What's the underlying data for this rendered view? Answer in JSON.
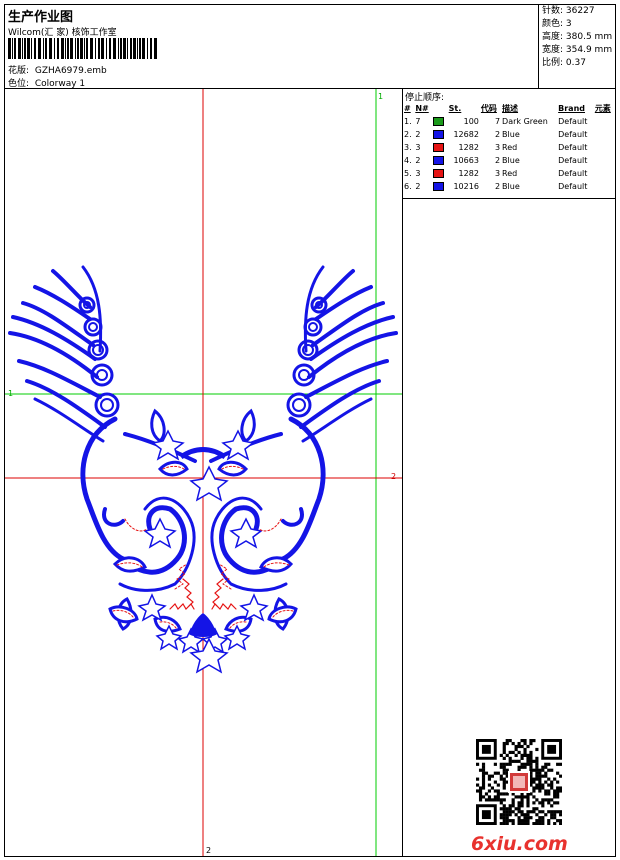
{
  "header": {
    "title": "生产作业图",
    "company": "Wilcom(汇 家) 核饰工作室",
    "meta": [
      {
        "label": "花版:",
        "value": "GZHA6979.emb"
      },
      {
        "label": "色位:",
        "value": "Colorway 1"
      }
    ]
  },
  "stats": [
    {
      "label": "针数:",
      "value": "36227"
    },
    {
      "label": "颜色:",
      "value": "3"
    },
    {
      "label": "高度:",
      "value": "380.5 mm"
    },
    {
      "label": "宽度:",
      "value": "354.9 mm"
    },
    {
      "label": "比例:",
      "value": "0.37"
    }
  ],
  "sequence": {
    "title": "停止顺序:",
    "headers": {
      "idx": "#",
      "n": "N#",
      "st": "St.",
      "code": "代码",
      "desc": "描述",
      "brand": "Brand",
      "elem": "元素"
    },
    "rows": [
      {
        "idx": "1.",
        "n": "7",
        "color": "#1a9a1a",
        "st": "100",
        "code": "7",
        "desc": "Dark Green",
        "brand": "Default"
      },
      {
        "idx": "2.",
        "n": "2",
        "color": "#1414e6",
        "st": "12682",
        "code": "2",
        "desc": "Blue",
        "brand": "Default"
      },
      {
        "idx": "3.",
        "n": "3",
        "color": "#e61414",
        "st": "1282",
        "code": "3",
        "desc": "Red",
        "brand": "Default"
      },
      {
        "idx": "4.",
        "n": "2",
        "color": "#1414e6",
        "st": "10663",
        "code": "2",
        "desc": "Blue",
        "brand": "Default"
      },
      {
        "idx": "5.",
        "n": "3",
        "color": "#e61414",
        "st": "1282",
        "code": "3",
        "desc": "Red",
        "brand": "Default"
      },
      {
        "idx": "6.",
        "n": "2",
        "color": "#1414e6",
        "st": "10216",
        "code": "2",
        "desc": "Blue",
        "brand": "Default"
      }
    ]
  },
  "axes": {
    "green_v": "1",
    "green_h": "1",
    "red_h": "2",
    "red_v": "2"
  },
  "watermark": "6xiu.com",
  "colors": {
    "design_blue": "#1414e6",
    "design_red": "#e61414",
    "guide_green": "#00cc00",
    "guide_red": "#dd0000"
  }
}
